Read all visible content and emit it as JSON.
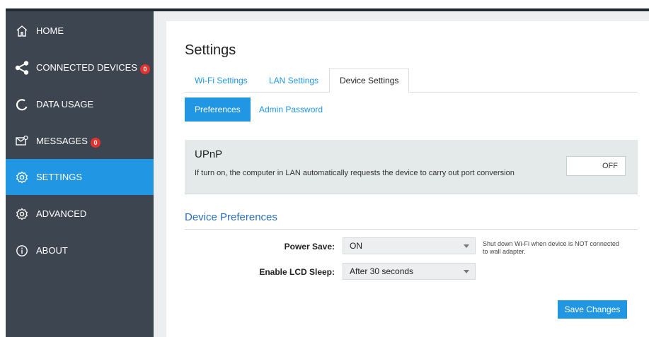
{
  "sidebar": {
    "items": [
      {
        "label": "HOME",
        "icon": "home-icon"
      },
      {
        "label": "CONNECTED DEVICES",
        "icon": "share-icon",
        "badge": "0"
      },
      {
        "label": "DATA USAGE",
        "icon": "data-usage-icon"
      },
      {
        "label": "MESSAGES",
        "icon": "messages-icon",
        "badge": "0"
      },
      {
        "label": "SETTINGS",
        "icon": "gear-icon",
        "active": true
      },
      {
        "label": "ADVANCED",
        "icon": "gear-icon"
      },
      {
        "label": "ABOUT",
        "icon": "info-icon"
      }
    ],
    "colors": {
      "background": "#3d4550",
      "active": "#2196e3"
    }
  },
  "main": {
    "title": "Settings",
    "tabs": [
      {
        "label": "Wi-Fi Settings"
      },
      {
        "label": "LAN Settings"
      },
      {
        "label": "Device Settings",
        "active": true
      }
    ],
    "subtabs": [
      {
        "label": "Preferences",
        "active": true
      },
      {
        "label": "Admin Password"
      }
    ],
    "upnp": {
      "title": "UPnP",
      "description": "If turn on, the computer in LAN automatically requests the device to carry out port conversion",
      "toggle_label": "OFF"
    },
    "device_preferences": {
      "title": "Device Preferences",
      "power_save_label": "Power Save:",
      "power_save_value": "ON",
      "power_save_hint": "Shut down Wi-Fi when device is NOT connected to wall adapter.",
      "lcd_sleep_label": "Enable LCD Sleep:",
      "lcd_sleep_value": "After 30 seconds"
    },
    "save_label": "Save Changes"
  }
}
